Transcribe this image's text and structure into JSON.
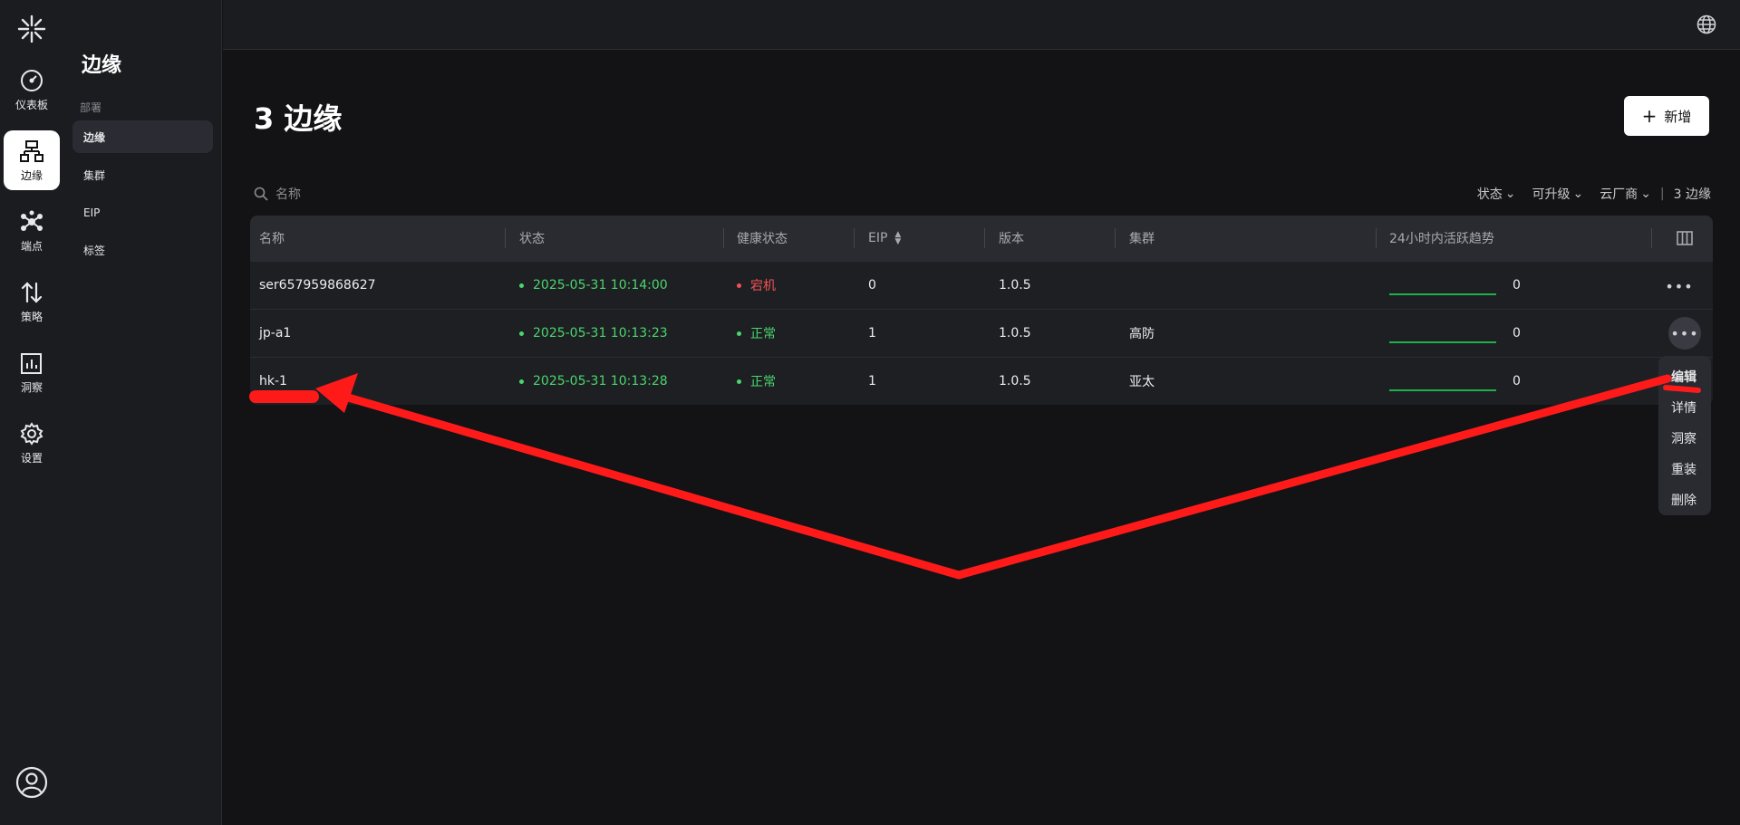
{
  "rail": {
    "items": [
      {
        "label": "仪表板",
        "icon": "gauge-icon"
      },
      {
        "label": "边缘",
        "icon": "sitemap-icon"
      },
      {
        "label": "端点",
        "icon": "network-icon"
      },
      {
        "label": "策略",
        "icon": "arrows-updown-icon"
      },
      {
        "label": "洞察",
        "icon": "chart-icon"
      },
      {
        "label": "设置",
        "icon": "gear-icon"
      }
    ]
  },
  "subnav": {
    "title": "边缘",
    "group": "部署",
    "items": [
      "边缘",
      "集群",
      "EIP",
      "标签"
    ]
  },
  "page": {
    "title": "3 边缘",
    "add_label": "新增"
  },
  "search": {
    "placeholder": "名称"
  },
  "filters": {
    "status": "状态",
    "upgradable": "可升级",
    "vendor": "云厂商",
    "count": "3 边缘"
  },
  "table": {
    "columns": [
      "名称",
      "状态",
      "健康状态",
      "EIP",
      "版本",
      "集群",
      "24小时内活跃趋势"
    ],
    "rows": [
      {
        "name": "ser657959868627",
        "status": "2025-05-31 10:14:00",
        "health": "宕机",
        "eip": "0",
        "version": "1.0.5",
        "cluster": "",
        "trend": "0"
      },
      {
        "name": "jp-a1",
        "status": "2025-05-31 10:13:23",
        "health": "正常",
        "eip": "1",
        "version": "1.0.5",
        "cluster": "高防",
        "trend": "0"
      },
      {
        "name": "hk-1",
        "status": "2025-05-31 10:13:28",
        "health": "正常",
        "eip": "1",
        "version": "1.0.5",
        "cluster": "亚太",
        "trend": "0"
      }
    ]
  },
  "menu": {
    "items": [
      "编辑",
      "详情",
      "洞察",
      "重装",
      "删除"
    ]
  },
  "colors": {
    "ok": "#4ad66d",
    "down": "#f05353",
    "annotation": "#ff1a1a"
  }
}
